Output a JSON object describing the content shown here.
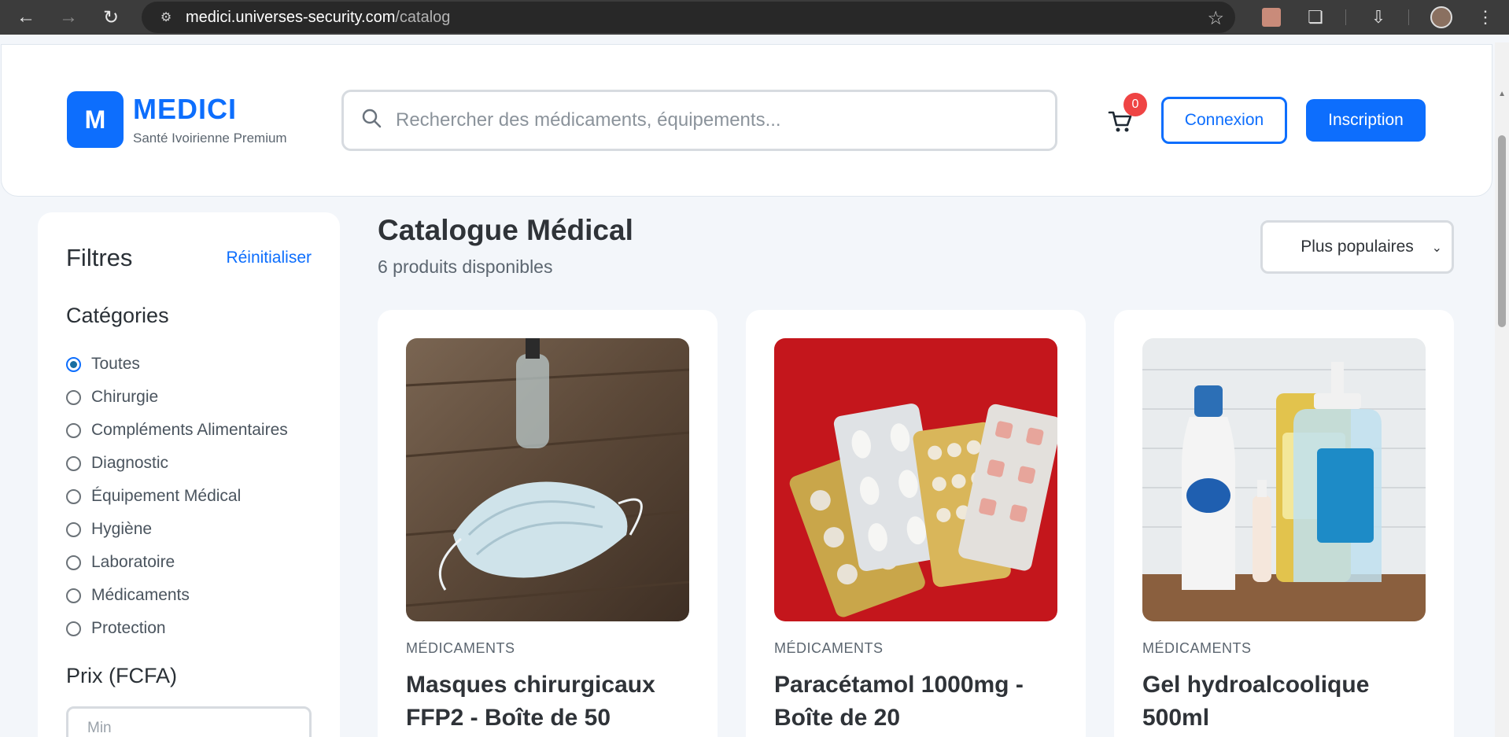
{
  "browser": {
    "url_host": "medici.universes-security.com",
    "url_path": "/catalog"
  },
  "header": {
    "logo_letter": "M",
    "brand": "MEDICI",
    "tagline": "Santé Ivoirienne Premium",
    "search_placeholder": "Rechercher des médicaments, équipements...",
    "cart_count": "0",
    "login_label": "Connexion",
    "signup_label": "Inscription"
  },
  "sidebar": {
    "title": "Filtres",
    "reset_label": "Réinitialiser",
    "categories_title": "Catégories",
    "categories": [
      {
        "label": "Toutes",
        "checked": true
      },
      {
        "label": "Chirurgie",
        "checked": false
      },
      {
        "label": "Compléments Alimentaires",
        "checked": false
      },
      {
        "label": "Diagnostic",
        "checked": false
      },
      {
        "label": "Équipement Médical",
        "checked": false
      },
      {
        "label": "Hygiène",
        "checked": false
      },
      {
        "label": "Laboratoire",
        "checked": false
      },
      {
        "label": "Médicaments",
        "checked": false
      },
      {
        "label": "Protection",
        "checked": false
      }
    ],
    "price_title": "Prix (FCFA)",
    "price_min_placeholder": "Min"
  },
  "main": {
    "title": "Catalogue Médical",
    "count_text": "6 produits disponibles",
    "sort_selected": "Plus populaires",
    "products": [
      {
        "category": "MÉDICAMENTS",
        "name": "Masques chirurgicaux FFP2 - Boîte de 50",
        "image": "surgical-mask-photo"
      },
      {
        "category": "MÉDICAMENTS",
        "name": "Paracétamol 1000mg - Boîte de 20",
        "image": "pill-blister-photo"
      },
      {
        "category": "MÉDICAMENTS",
        "name": "Gel hydroalcoolique 500ml",
        "image": "sanitizer-bottles-photo"
      }
    ]
  },
  "colors": {
    "accent": "#0d6efd",
    "badge": "#ef4444",
    "page_bg": "#f3f6fa"
  }
}
